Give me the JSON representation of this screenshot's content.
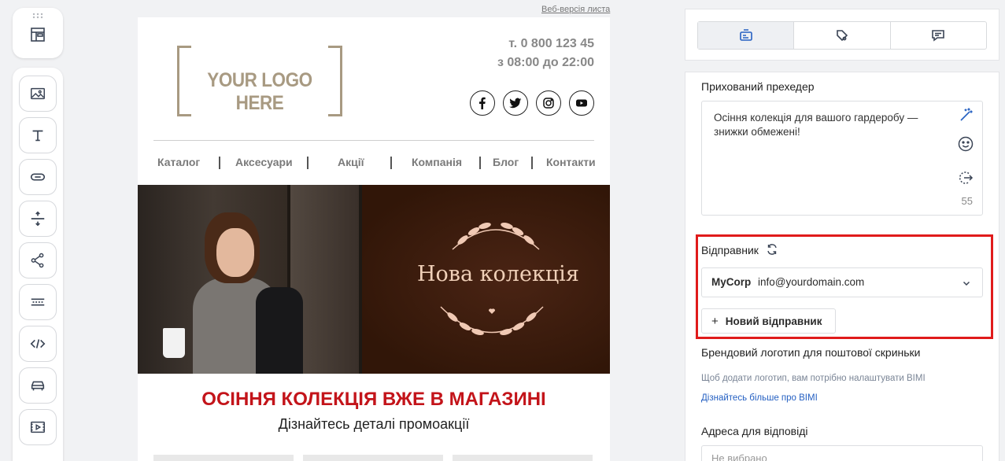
{
  "email": {
    "web_version_link": "Веб-версія листа",
    "logo_text": "YOUR LOGO HERE",
    "phone": "т. 0 800 123 45",
    "hours": "з 08:00 до 22:00",
    "nav": [
      "Каталог",
      "Аксесуари",
      "Акції",
      "Компанія",
      "Блог",
      "Контакти"
    ],
    "hero_title": "Нова колекція",
    "headline": "ОСІННЯ КОЛЕКЦІЯ ВЖЕ В МАГАЗИНІ",
    "subheadline": "Дізнайтесь деталі промоакції"
  },
  "settings": {
    "preheader_label": "Прихований прехедер",
    "preheader_text": "Осіння колекція для вашого гардеробу — знижки обмежені!",
    "preheader_counter": "55",
    "sender_label": "Відправник",
    "sender_name": "MyCorp",
    "sender_email": "info@yourdomain.com",
    "new_sender_label": "Новий відправник",
    "brand_logo_label": "Брендовий логотип для поштової скриньки",
    "bimi_hint": "Щоб додати логотип, вам потрібно налаштувати BIMI",
    "bimi_link": "Дізнайтесь більше про BIMI",
    "reply_label": "Адреса для відповіді",
    "reply_placeholder": "Не вибрано"
  },
  "colors": {
    "accent_red": "#c3141a",
    "highlight": "#e01b1b",
    "link": "#2560c2",
    "logo": "#a89a82"
  }
}
